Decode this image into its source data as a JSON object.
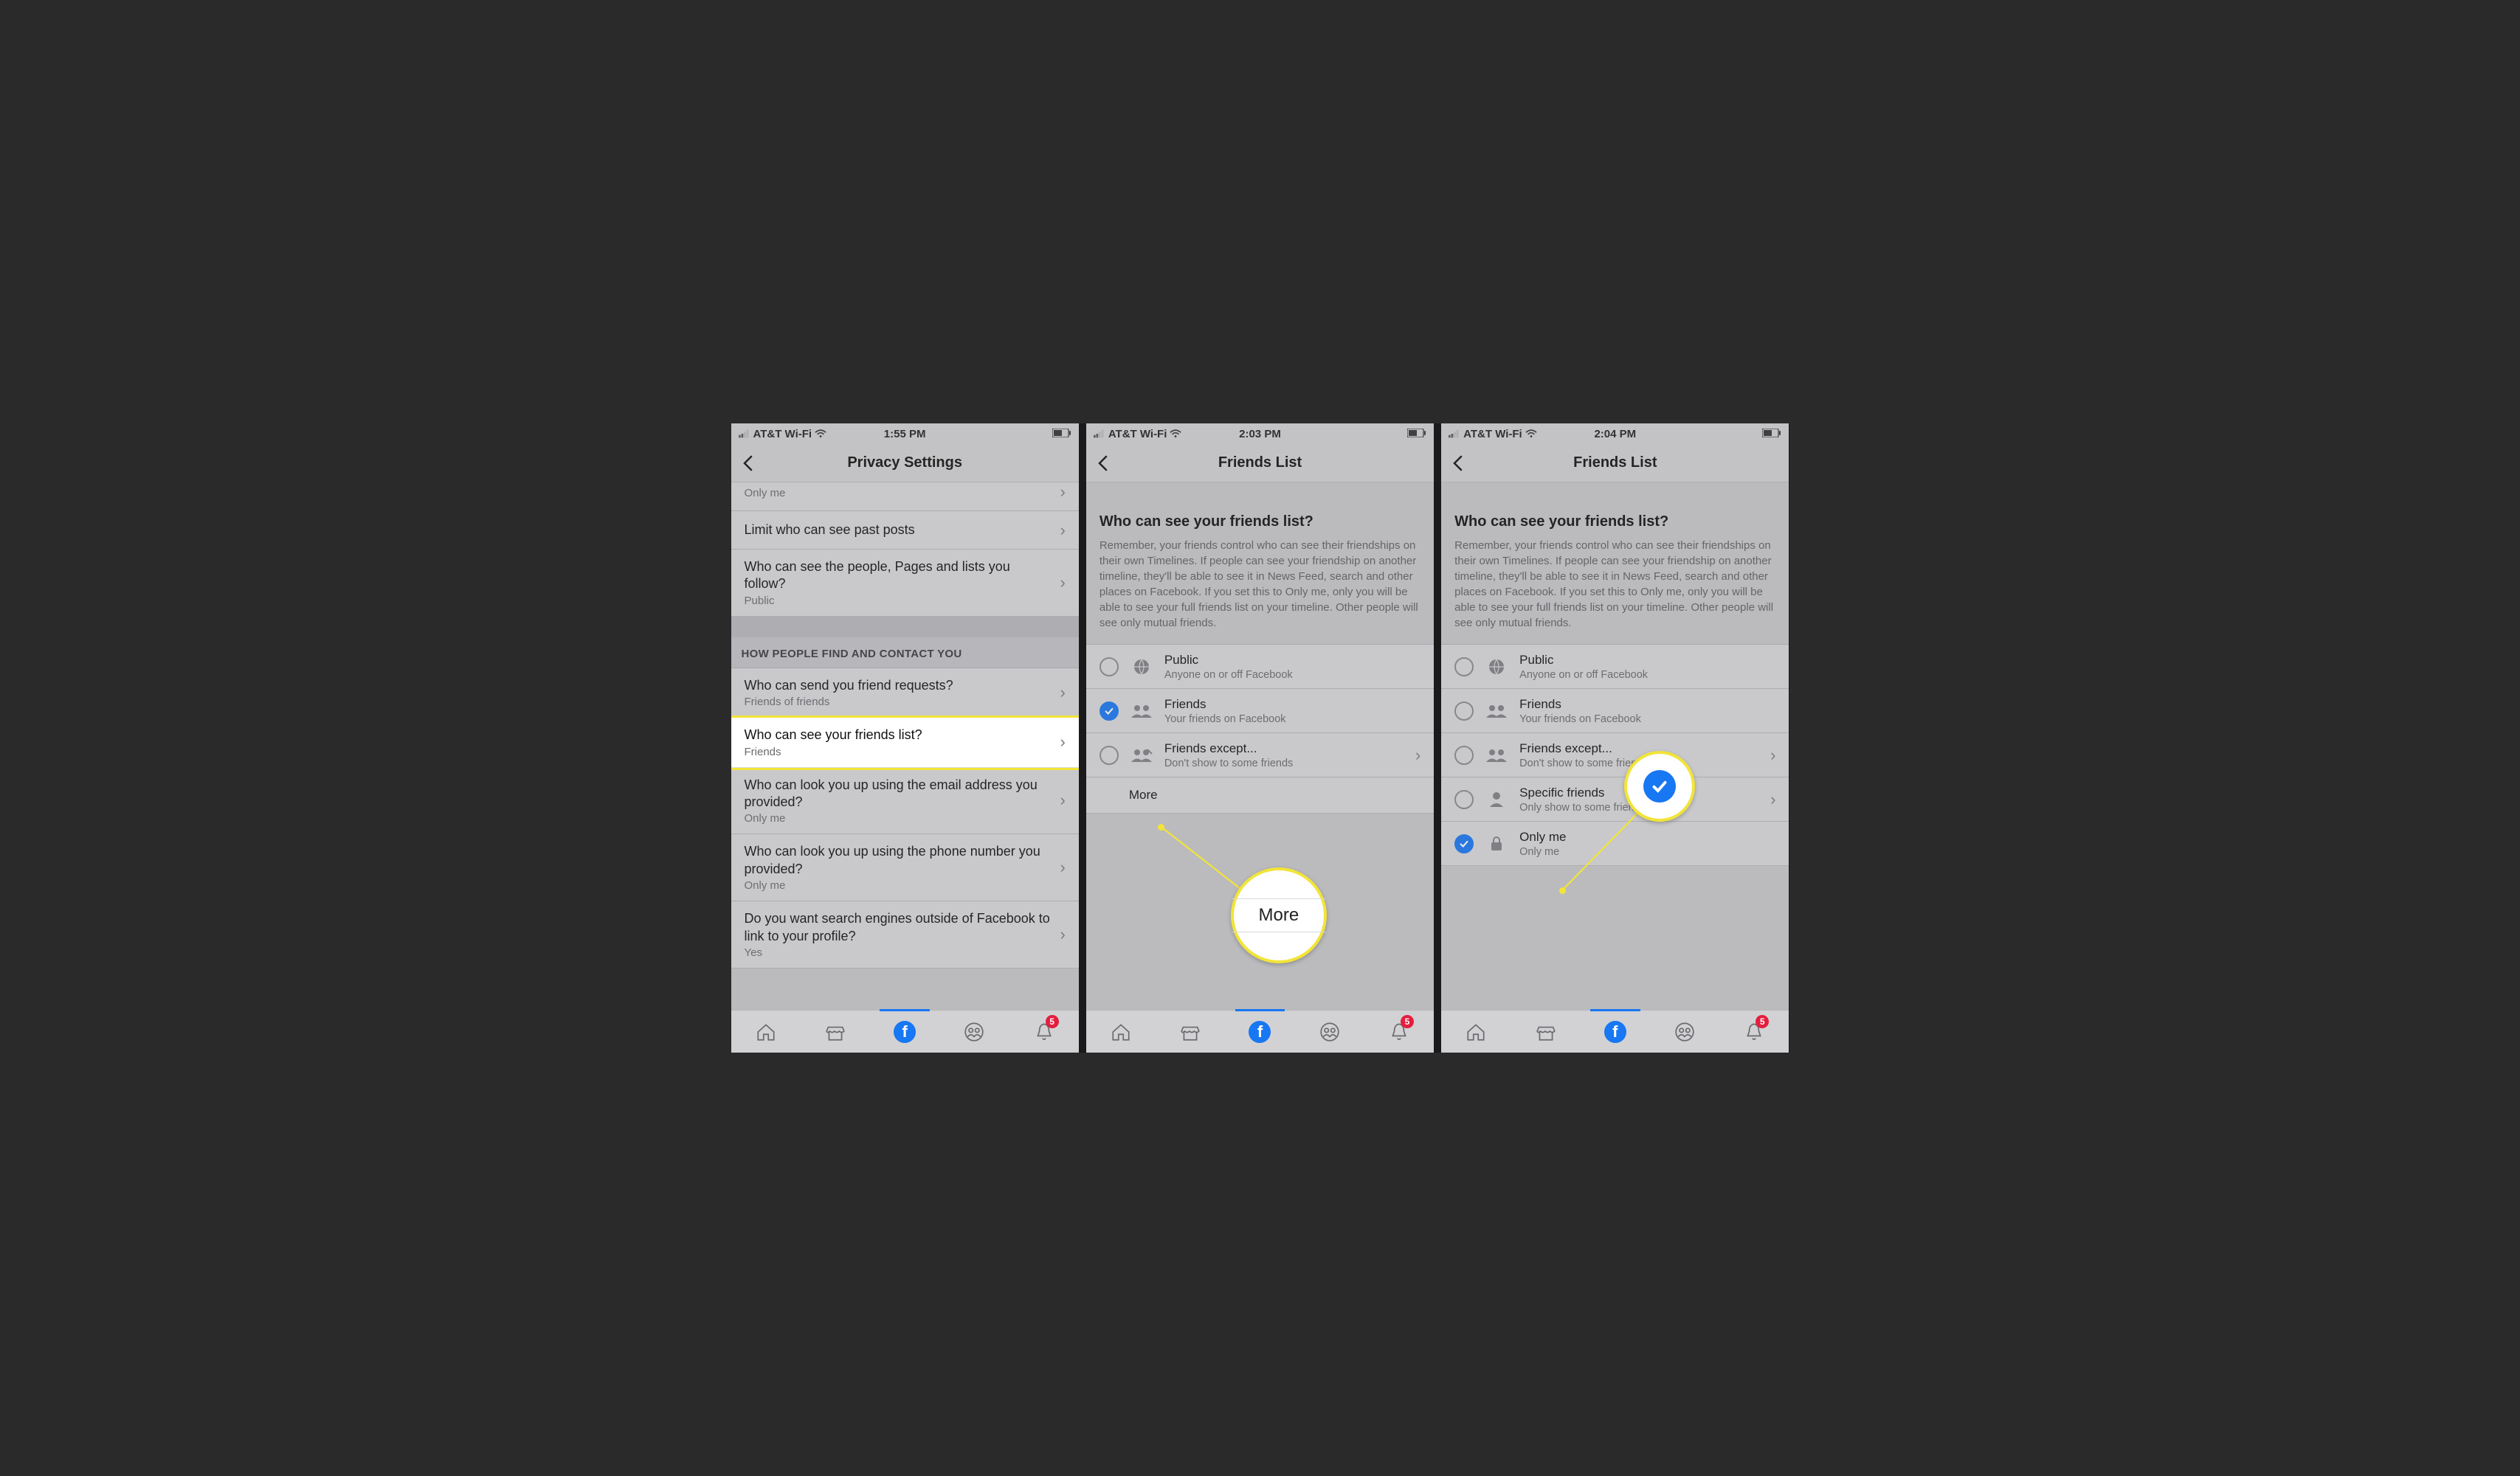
{
  "colors": {
    "accent": "#1877f2",
    "highlight": "#f2e438",
    "badge": "#e41e3f"
  },
  "statusbar": {
    "carrier": "AT&T Wi-Fi"
  },
  "screen1": {
    "time": "1:55 PM",
    "header": "Privacy Settings",
    "rows": {
      "first_sub": "Only me",
      "limit_past": "Limit who can see past posts",
      "follow_title": "Who can see the people, Pages and lists you follow?",
      "follow_sub": "Public",
      "section": "HOW PEOPLE FIND AND CONTACT YOU",
      "friend_req_title": "Who can send you friend requests?",
      "friend_req_sub": "Friends of friends",
      "friends_list_title": "Who can see your friends list?",
      "friends_list_sub": "Friends",
      "email_title": "Who can look you up using the email address you provided?",
      "email_sub": "Only me",
      "phone_title": "Who can look you up using the phone number you provided?",
      "phone_sub": "Only me",
      "search_title": "Do you want search engines outside of Facebook to link to your profile?",
      "search_sub": "Yes"
    }
  },
  "screen2": {
    "time": "2:03 PM",
    "header": "Friends List",
    "desc_title": "Who can see your friends list?",
    "desc_text": "Remember, your friends control who can see their friendships on their own Timelines. If people can see your friendship on another timeline, they'll be able to see it in News Feed, search and other places on Facebook. If you set this to Only me, only you will be able to see your full friends list on your timeline. Other people will see only mutual friends.",
    "options": {
      "public": {
        "title": "Public",
        "sub": "Anyone on or off Facebook"
      },
      "friends": {
        "title": "Friends",
        "sub": "Your friends on Facebook"
      },
      "except": {
        "title": "Friends except...",
        "sub": "Don't show to some friends"
      }
    },
    "more": "More",
    "callout_more": "More"
  },
  "screen3": {
    "time": "2:04 PM",
    "header": "Friends List",
    "desc_title": "Who can see your friends list?",
    "desc_text": "Remember, your friends control who can see their friendships on their own Timelines. If people can see your friendship on another timeline, they'll be able to see it in News Feed, search and other places on Facebook. If you set this to Only me, only you will be able to see your full friends list on your timeline. Other people will see only mutual friends.",
    "options": {
      "public": {
        "title": "Public",
        "sub": "Anyone on or off Facebook"
      },
      "friends": {
        "title": "Friends",
        "sub": "Your friends on Facebook"
      },
      "except": {
        "title": "Friends except...",
        "sub": "Don't show to some friends"
      },
      "specific": {
        "title": "Specific friends",
        "sub": "Only show to some friends"
      },
      "onlyme": {
        "title": "Only me",
        "sub": "Only me"
      }
    }
  },
  "tabbar": {
    "badge": "5"
  }
}
